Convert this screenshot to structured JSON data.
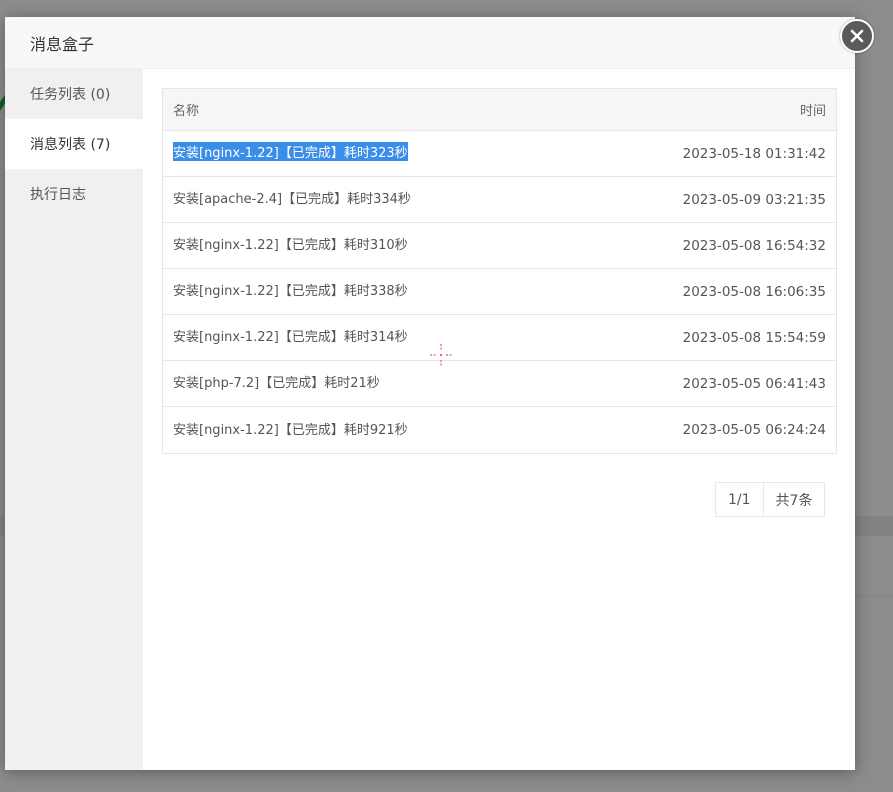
{
  "dialog": {
    "title": "消息盒子"
  },
  "sidebar": {
    "items": [
      {
        "label": "任务列表 (0)"
      },
      {
        "label": "消息列表 (7)"
      },
      {
        "label": "执行日志"
      }
    ]
  },
  "table": {
    "headers": {
      "name": "名称",
      "time": "时间"
    },
    "rows": [
      {
        "name": "安装[nginx-1.22]【已完成】耗时323秒",
        "time": "2023-05-18 01:31:42"
      },
      {
        "name": "安装[apache-2.4]【已完成】耗时334秒",
        "time": "2023-05-09 03:21:35"
      },
      {
        "name": "安装[nginx-1.22]【已完成】耗时310秒",
        "time": "2023-05-08 16:54:32"
      },
      {
        "name": "安装[nginx-1.22]【已完成】耗时338秒",
        "time": "2023-05-08 16:06:35"
      },
      {
        "name": "安装[nginx-1.22]【已完成】耗时314秒",
        "time": "2023-05-08 15:54:59"
      },
      {
        "name": "安装[php-7.2]【已完成】耗时21秒",
        "time": "2023-05-05 06:41:43"
      },
      {
        "name": "安装[nginx-1.22]【已完成】耗时921秒",
        "time": "2023-05-05 06:24:24"
      }
    ]
  },
  "pager": {
    "page": "1/1",
    "total": "共7条"
  },
  "colors": {
    "selection": "#3b8ee8",
    "close_button": "#5a5a5a",
    "sidebar_bg": "#f0f0f0",
    "header_bg": "#f8f8f8"
  }
}
